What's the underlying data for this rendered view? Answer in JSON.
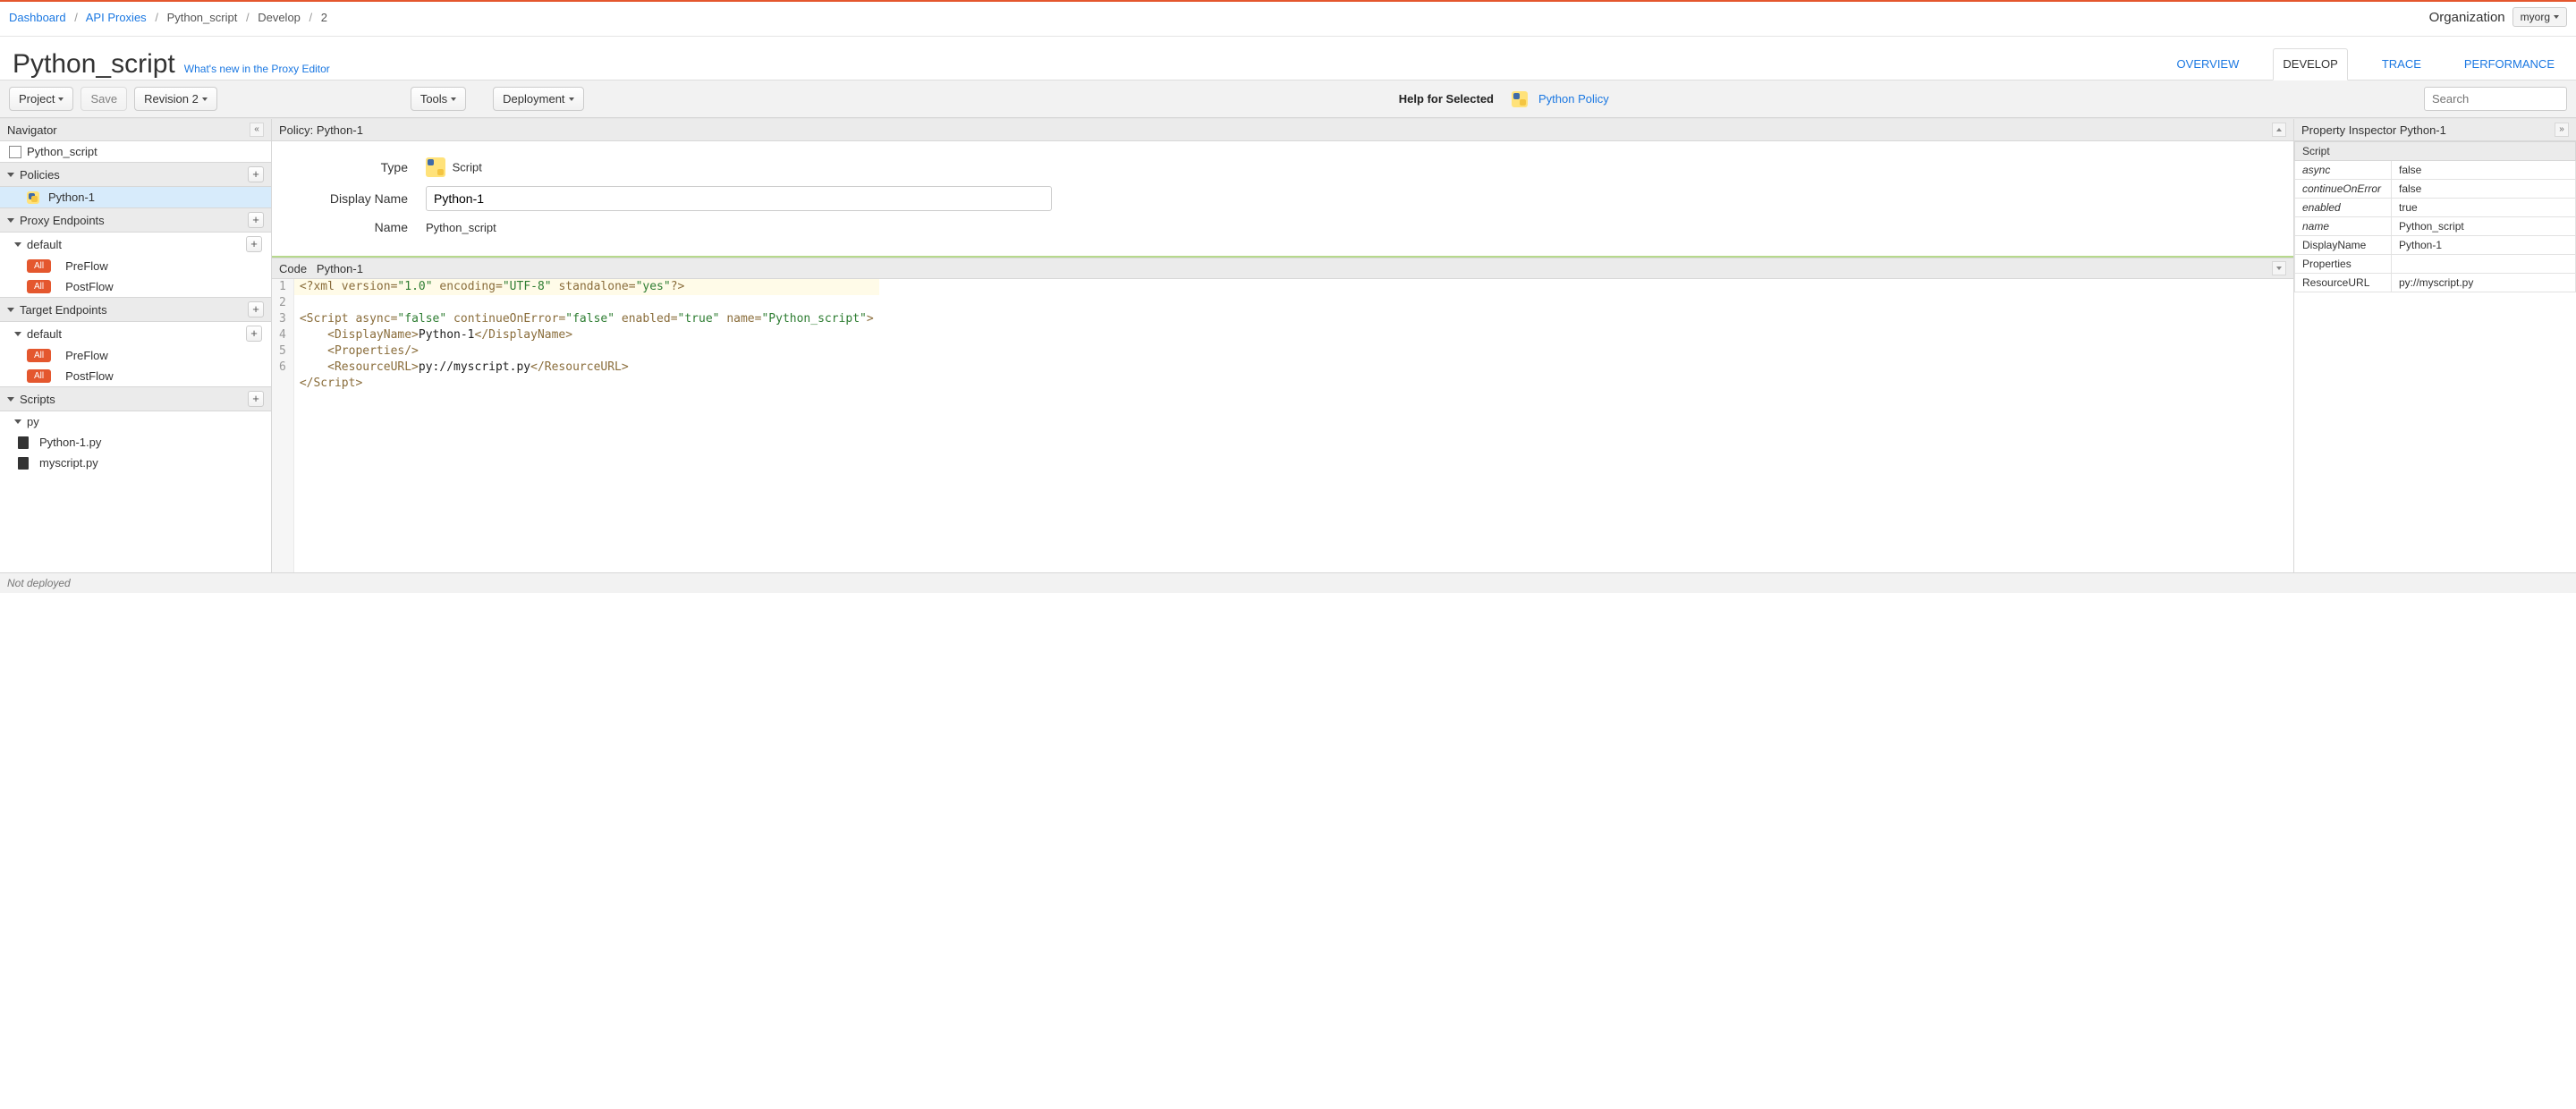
{
  "breadcrumbs": {
    "items": [
      {
        "label": "Dashboard",
        "link": true
      },
      {
        "label": "API Proxies",
        "link": true
      },
      {
        "label": "Python_script",
        "link": false
      },
      {
        "label": "Develop",
        "link": false
      },
      {
        "label": "2",
        "link": false
      }
    ]
  },
  "org": {
    "label": "Organization",
    "value": "myorg"
  },
  "title": "Python_script",
  "whatsnew": "What's new in the Proxy Editor",
  "tabs": {
    "overview": "OVERVIEW",
    "develop": "DEVELOP",
    "trace": "TRACE",
    "performance": "PERFORMANCE"
  },
  "toolbar": {
    "project": "Project",
    "save": "Save",
    "revision": "Revision 2",
    "tools": "Tools",
    "deployment": "Deployment",
    "help_label": "Help for Selected",
    "policy_link": "Python Policy",
    "search_placeholder": "Search"
  },
  "navigator": {
    "title": "Navigator",
    "root": "Python_script",
    "policies_hdr": "Policies",
    "policies": [
      {
        "label": "Python-1"
      }
    ],
    "proxy_hdr": "Proxy Endpoints",
    "proxy_default": "default",
    "proxy_flows": {
      "preflow": "PreFlow",
      "postflow": "PostFlow",
      "all": "All"
    },
    "target_hdr": "Target Endpoints",
    "target_default": "default",
    "target_flows": {
      "preflow": "PreFlow",
      "postflow": "PostFlow",
      "all": "All"
    },
    "scripts_hdr": "Scripts",
    "scripts_folder": "py",
    "scripts": {
      "f1": "Python-1.py",
      "f2": "myscript.py"
    }
  },
  "policy_panel": {
    "title": "Policy: Python-1",
    "form": {
      "type_label": "Type",
      "type_value": "Script",
      "display_label": "Display Name",
      "display_value": "Python-1",
      "name_label": "Name",
      "name_value": "Python_script"
    }
  },
  "code": {
    "title_prefix": "Code",
    "title_name": "Python-1",
    "lines": {
      "n1": "1",
      "n2": "2",
      "n3": "3",
      "n4": "4",
      "n5": "5",
      "n6": "6"
    }
  },
  "property_inspector": {
    "title": "Property Inspector  Python-1",
    "section": "Script",
    "rows": {
      "async_k": "async",
      "async_v": "false",
      "coe_k": "continueOnError",
      "coe_v": "false",
      "enabled_k": "enabled",
      "enabled_v": "true",
      "name_k": "name",
      "name_v": "Python_script",
      "dname_k": "DisplayName",
      "dname_v": "Python-1",
      "props_k": "Properties",
      "props_v": "",
      "rurl_k": "ResourceURL",
      "rurl_v": "py://myscript.py"
    }
  },
  "status": "Not deployed"
}
